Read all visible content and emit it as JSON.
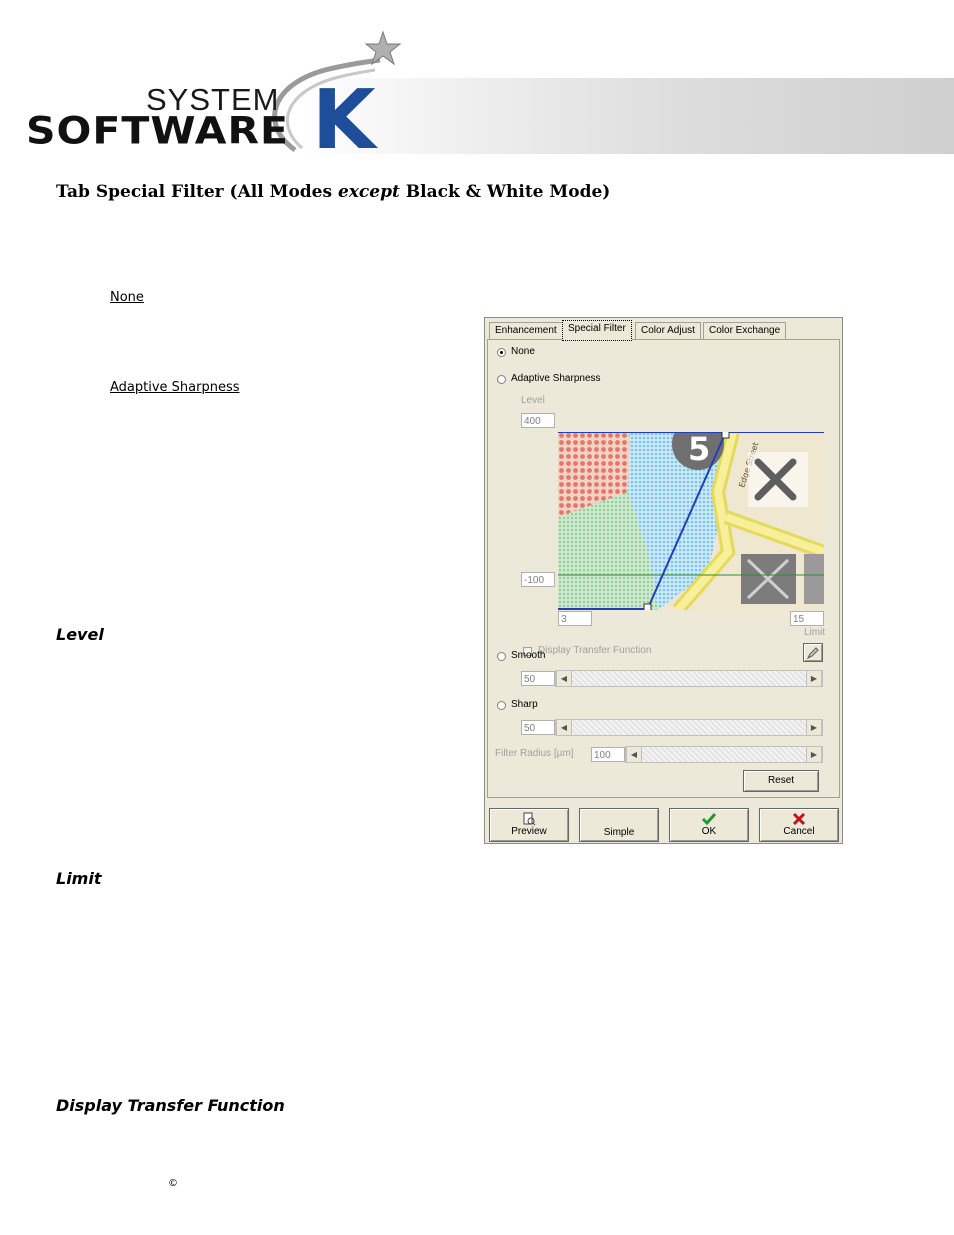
{
  "header": {
    "logo_top": "SYSTEM",
    "logo_bottom": "SOFTWARE",
    "logo_letter": "K",
    "brand_color": "#1e4d9a"
  },
  "doc": {
    "heading_prefix": "Tab Special Filter (All Modes ",
    "heading_em": "except",
    "heading_suffix": " Black & White Mode)",
    "link_none": "None",
    "link_adaptive": "Adaptive Sharpness",
    "sub_level": "Level",
    "sub_limit": "Limit",
    "sub_display": "Display Transfer Function",
    "copyright": "©"
  },
  "dialog": {
    "tabs": [
      "Enhancement",
      "Special Filter",
      "Color Adjust",
      "Color Exchange"
    ],
    "active_tab": "Special Filter",
    "radio_none": "None",
    "radio_adaptive": "Adaptive Sharpness",
    "selected_radio": "None",
    "level_label": "Level",
    "level_max": "400",
    "level_min": "-100",
    "limit_min": "3",
    "limit_max": "15",
    "limit_label": "Limit",
    "display_tf_label": "Display Transfer Function",
    "radio_smooth": "Smooth",
    "smooth_value": "50",
    "radio_sharp": "Sharp",
    "sharp_value": "50",
    "filter_radius_label": "Filter Radius [µm]",
    "filter_radius_value": "100",
    "reset_label": "Reset",
    "buttons": {
      "preview": "Preview",
      "simple": "Simple",
      "ok": "OK",
      "cancel": "Cancel"
    },
    "preview_map_text": {
      "street": "Edge Street"
    }
  }
}
